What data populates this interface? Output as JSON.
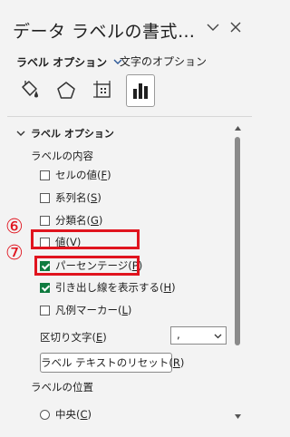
{
  "pane": {
    "title": "データ ラベルの書式…",
    "category_label": "ラベル オプション",
    "text_options_label": "文字のオプション"
  },
  "icons": {
    "collapse": "chevron-down-icon",
    "close": "close-icon",
    "tabs": [
      "paint-bucket-icon",
      "pentagon-effects-icon",
      "size-properties-icon",
      "bar-chart-icon"
    ]
  },
  "section": {
    "title": "ラベル オプション",
    "label_contains_heading": "ラベルの内容",
    "options": [
      {
        "label": "セルの値",
        "key": "F",
        "checked": false
      },
      {
        "label": "系列名",
        "key": "S",
        "checked": false
      },
      {
        "label": "分類名",
        "key": "G",
        "checked": false
      },
      {
        "label": "値",
        "key": "V",
        "checked": false
      },
      {
        "label": "パーセンテージ",
        "key": "P",
        "checked": true
      },
      {
        "label": "引き出し線を表示する",
        "key": "H",
        "checked": true
      },
      {
        "label": "凡例マーカー",
        "key": "L",
        "checked": false
      }
    ],
    "separator_label": "区切り文字",
    "separator_key": "E",
    "separator_value": ",",
    "reset_label": "ラベル テキストのリセット",
    "reset_key": "R",
    "label_position_heading": "ラベルの位置",
    "position_option": "中央",
    "position_key": "C"
  },
  "annotations": {
    "marker_6": "⑥",
    "marker_7": "⑦"
  },
  "colors": {
    "accent_green": "#0f7b3f",
    "highlight_red": "#e0141e",
    "panel_bg": "#f3f3f3"
  }
}
